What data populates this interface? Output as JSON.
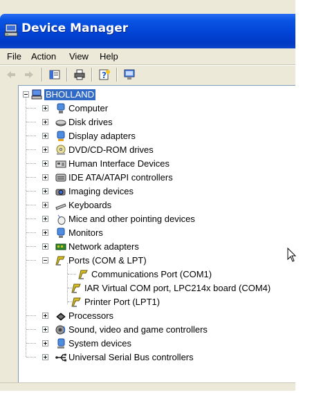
{
  "window": {
    "title": "Device Manager",
    "title_icon": "device-manager-icon"
  },
  "menu": [
    "File",
    "Action",
    "View",
    "Help"
  ],
  "toolbar": {
    "buttons": [
      "back-icon",
      "forward-icon",
      "properties-icon",
      "print-icon",
      "help-icon",
      "scan-hardware-icon"
    ]
  },
  "tree": {
    "root": "BHOLLAND",
    "categories": [
      "Computer",
      "Disk drives",
      "Display adapters",
      "DVD/CD-ROM drives",
      "Human Interface Devices",
      "IDE ATA/ATAPI controllers",
      "Imaging devices",
      "Keyboards",
      "Mice and other pointing devices",
      "Monitors",
      "Network adapters",
      "Ports (COM & LPT)",
      "Processors",
      "Sound, video and game controllers",
      "System devices",
      "Universal Serial Bus controllers"
    ],
    "ports_children": [
      "Communications Port (COM1)",
      "IAR Virtual COM port, LPC214x board (COM4)",
      "Printer Port (LPT1)"
    ]
  },
  "colors": {
    "title_blue": "#0243d6",
    "selection": "#316ac5",
    "chrome": "#ece9d8"
  }
}
